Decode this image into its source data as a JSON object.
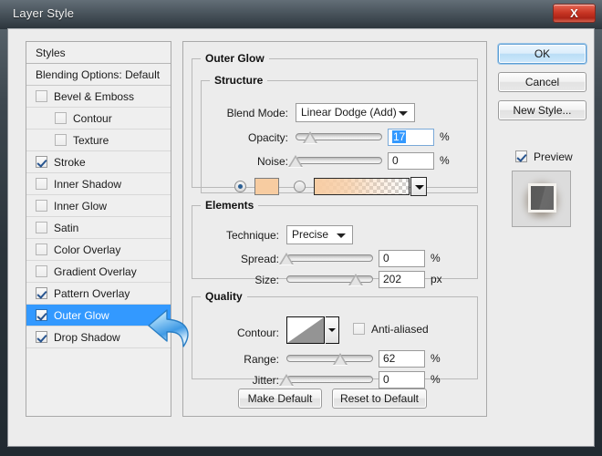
{
  "window": {
    "title": "Layer Style",
    "close_label": "X"
  },
  "styles_list": {
    "header": "Styles",
    "blending_options": "Blending Options: Default",
    "items": [
      {
        "label": "Bevel & Emboss",
        "checked": false,
        "indent": false,
        "selected": false
      },
      {
        "label": "Contour",
        "checked": false,
        "indent": true,
        "selected": false
      },
      {
        "label": "Texture",
        "checked": false,
        "indent": true,
        "selected": false
      },
      {
        "label": "Stroke",
        "checked": true,
        "indent": false,
        "selected": false
      },
      {
        "label": "Inner Shadow",
        "checked": false,
        "indent": false,
        "selected": false
      },
      {
        "label": "Inner Glow",
        "checked": false,
        "indent": false,
        "selected": false
      },
      {
        "label": "Satin",
        "checked": false,
        "indent": false,
        "selected": false
      },
      {
        "label": "Color Overlay",
        "checked": false,
        "indent": false,
        "selected": false
      },
      {
        "label": "Gradient Overlay",
        "checked": false,
        "indent": false,
        "selected": false
      },
      {
        "label": "Pattern Overlay",
        "checked": true,
        "indent": false,
        "selected": false
      },
      {
        "label": "Outer Glow",
        "checked": true,
        "indent": false,
        "selected": true
      },
      {
        "label": "Drop Shadow",
        "checked": true,
        "indent": false,
        "selected": false
      }
    ]
  },
  "main": {
    "group_title": "Outer Glow",
    "structure": {
      "title": "Structure",
      "blend_mode_label": "Blend Mode:",
      "blend_mode_value": "Linear Dodge (Add)",
      "opacity_label": "Opacity:",
      "opacity_value": "17",
      "opacity_unit": "%",
      "opacity_percent": 17,
      "noise_label": "Noise:",
      "noise_value": "0",
      "noise_unit": "%",
      "noise_percent": 0,
      "fill_mode": "color",
      "color_swatch_hex": "#f7cca1",
      "gradient_from_hex": "#f8cda4",
      "gradient_to_hex": "#f8cda4"
    },
    "elements": {
      "title": "Elements",
      "technique_label": "Technique:",
      "technique_value": "Precise",
      "spread_label": "Spread:",
      "spread_value": "0",
      "spread_unit": "%",
      "spread_percent": 0,
      "size_label": "Size:",
      "size_value": "202",
      "size_unit": "px",
      "size_percent": 80
    },
    "quality": {
      "title": "Quality",
      "contour_label": "Contour:",
      "anti_aliased_label": "Anti-aliased",
      "anti_aliased_checked": false,
      "range_label": "Range:",
      "range_value": "62",
      "range_unit": "%",
      "range_percent": 62,
      "jitter_label": "Jitter:",
      "jitter_value": "0",
      "jitter_unit": "%",
      "jitter_percent": 0
    },
    "buttons": {
      "make_default": "Make Default",
      "reset_to_default": "Reset to Default"
    }
  },
  "right": {
    "ok": "OK",
    "cancel": "Cancel",
    "new_style": "New Style...",
    "preview_label": "Preview",
    "preview_checked": true
  },
  "colors": {
    "selection_blue": "#3399ff",
    "close_red": "#c53322",
    "titlebar_dark": "#39434b",
    "dialog_bg": "#ececec"
  }
}
